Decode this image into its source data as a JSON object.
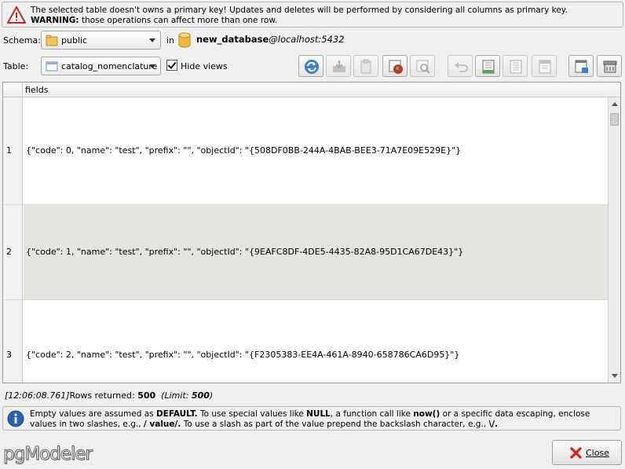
{
  "warning": {
    "text_plain": "The selected table doesn't owns a primary key! Updates and deletes will be performed by considering all columns as primary key. ",
    "text_bold": "WARNING:",
    "text_rest": " those operations can affect more than one row."
  },
  "schema": {
    "label": "Schema:",
    "value": "public",
    "in_label": "in"
  },
  "database": {
    "name": "new_database",
    "host": "@localhost:5432"
  },
  "table": {
    "label": "Table:",
    "value": "catalog_nomenclature",
    "hide_views_label": "Hide views",
    "hide_views_checked": true
  },
  "toolbar": {
    "buttons": [
      "refresh-icon",
      "save-icon",
      "paste-icon",
      "export-icon",
      "filter-icon",
      "undo-icon",
      "add-row-icon",
      "duplicate-row-icon",
      "delete-row-icon",
      "window-icon",
      "truncate-icon"
    ]
  },
  "grid": {
    "column": "fields",
    "rows": [
      {
        "num": "1",
        "value": "{\"code\": 0, \"name\": \"test\", \"prefix\": \"\", \"objectId\": \"{508DF0BB-244A-4BAB-BEE3-71A7E09E529E}\"}"
      },
      {
        "num": "2",
        "value": "{\"code\": 1, \"name\": \"test\", \"prefix\": \"\", \"objectId\": \"{9EAFC8DF-4DE5-4435-82A8-95D1CA67DE43}\"}"
      },
      {
        "num": "3",
        "value": "{\"code\": 2, \"name\": \"test\", \"prefix\": \"\", \"objectId\": \"{F2305383-EE4A-461A-8940-658786CA6D95}\"}"
      }
    ]
  },
  "status": {
    "time": "[12:06:08.761]",
    "rows_label": "Rows returned:",
    "rows_count": "500",
    "limit_label": "(Limit:",
    "limit_value": "500",
    "limit_close": ")"
  },
  "info": {
    "p1": "Empty values are assumed as ",
    "b1": "DEFAULT.",
    "p2": " To use special values like ",
    "b2": "NULL",
    "p3": ", a function call like ",
    "b3": "now()",
    "p4": " or a specific data escaping, enclose values in two slashes, e.g., ",
    "b4": "/ value/.",
    "p5": " To use a slash as part of the value prepend the backslash character, e.g., ",
    "b5": "\\/.",
    "p6": ""
  },
  "logo": "pgModeler",
  "close_button": "Close",
  "colors": {
    "alt_row": "#e4e4e0",
    "warning_red": "#d62020",
    "info_blue": "#2a62b8"
  }
}
